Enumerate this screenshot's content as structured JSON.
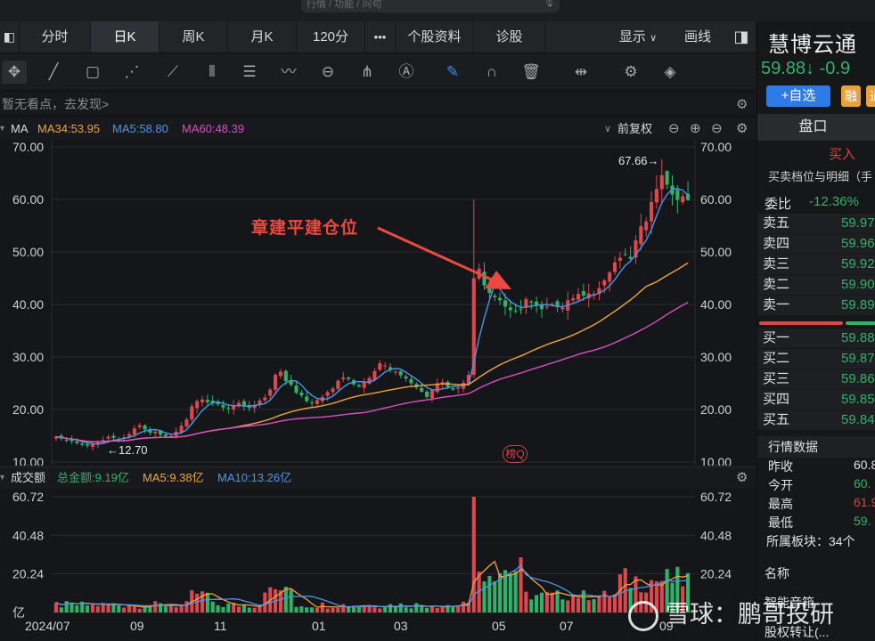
{
  "search": {
    "placeholder": "行情 / 功能 / 问句"
  },
  "tabs": [
    {
      "label": "分时"
    },
    {
      "label": "日K"
    },
    {
      "label": "周K"
    },
    {
      "label": "月K"
    },
    {
      "label": "120分"
    },
    {
      "label": "•••"
    },
    {
      "label": "个股资料"
    },
    {
      "label": "诊股"
    }
  ],
  "toolbar": {
    "display_label": "显示",
    "draw_label": "画线"
  },
  "notice": {
    "text": "暂无看点，去发现>"
  },
  "ma": {
    "label": "MA",
    "ma34": "MA34:53.95",
    "ma5": "MA5:58.80",
    "ma60": "MA60:48.39",
    "adjust": "前复权"
  },
  "volume": {
    "label": "成交额",
    "total": "总金额:9.19亿",
    "ma5": "MA5:9.38亿",
    "ma10": "MA10:13.26亿"
  },
  "annotation": {
    "text": "章建平建仓位"
  },
  "badge": {
    "text": "榜Q"
  },
  "colors": {
    "up": "#e0474c",
    "down": "#2fb36b",
    "ma5": "#4c95ea",
    "ma34": "#f2a33a",
    "ma60": "#d94fc4",
    "accent": "#e8463c"
  },
  "chart_data": [
    {
      "type": "candlestick",
      "title": "",
      "yticks_left": [
        "70.00",
        "60.00",
        "50.00",
        "40.00",
        "30.00",
        "20.00",
        "10.00"
      ],
      "yticks_right": [
        "70.00",
        "60.00",
        "50.00",
        "40.00",
        "30.00",
        "20.00",
        "10.00"
      ],
      "ylim": [
        10,
        70
      ],
      "xticks": [
        "2024/07",
        "09",
        "11",
        "01",
        "03",
        "05",
        "07",
        "09"
      ],
      "high_label": "67.66",
      "low_label": "12.70",
      "close_series": [
        14.8,
        14.5,
        14.2,
        14.0,
        13.6,
        13.3,
        13.1,
        13.4,
        13.7,
        14.2,
        14.8,
        14.6,
        14.2,
        14.7,
        15.3,
        16.4,
        17.0,
        16.2,
        15.6,
        15.8,
        15.2,
        14.9,
        15.0,
        15.8,
        16.9,
        18.1,
        20.6,
        21.6,
        21.9,
        21.4,
        21.2,
        21.0,
        20.4,
        20.2,
        20.8,
        21.3,
        20.6,
        20.3,
        20.8,
        21.7,
        22.3,
        23.8,
        26.6,
        27.2,
        25.4,
        24.7,
        23.2,
        22.7,
        21.6,
        21.2,
        21.8,
        22.4,
        23.3,
        24.0,
        25.5,
        26.1,
        25.8,
        24.8,
        24.4,
        25.2,
        26.0,
        27.3,
        28.8,
        28.4,
        27.5,
        27.2,
        26.5,
        25.9,
        25.0,
        24.2,
        23.4,
        22.4,
        23.7,
        25.0,
        25.2,
        24.3,
        23.8,
        24.2,
        25.1,
        26.6,
        45.0,
        46.8,
        43.6,
        42.2,
        41.4,
        40.8,
        39.6,
        38.9,
        38.7,
        39.2,
        41.0,
        40.5,
        39.8,
        39.1,
        39.6,
        40.1,
        39.5,
        39.4,
        40.8,
        41.2,
        42.0,
        41.7,
        42.1,
        42.0,
        43.1,
        44.6,
        46.1,
        48.0,
        48.9,
        49.5,
        48.7,
        52.2,
        54.9,
        55.8,
        59.5,
        62.0,
        64.6,
        62.8,
        60.9,
        59.9,
        60.6,
        59.9
      ]
    },
    {
      "type": "bar",
      "title": "",
      "yticks_left": [
        "60.72",
        "40.48",
        "20.24",
        "亿"
      ],
      "yticks_right": [
        "60.72",
        "40.48",
        "20.24"
      ],
      "ylim": [
        0,
        60.72
      ],
      "unit": "亿"
    }
  ],
  "quote": {
    "name": "慧博云通",
    "price": "59.88↓",
    "change": "-0.9",
    "add_watch": "+自选",
    "rong": "融",
    "tong": "通"
  },
  "panel": {
    "title": "盘口",
    "buy_tab": "买入",
    "depth_title": "买卖档位与明细（手",
    "weibi_label": "委比",
    "weibi_value": "-12.36%",
    "asks": [
      {
        "label": "卖五",
        "price": "59.97"
      },
      {
        "label": "卖四",
        "price": "59.96"
      },
      {
        "label": "卖三",
        "price": "59.92"
      },
      {
        "label": "卖二",
        "price": "59.90"
      },
      {
        "label": "卖一",
        "price": "59.89"
      }
    ],
    "bids": [
      {
        "label": "买一",
        "price": "59.88"
      },
      {
        "label": "买二",
        "price": "59.87"
      },
      {
        "label": "买三",
        "price": "59.86"
      },
      {
        "label": "买四",
        "price": "59.85"
      },
      {
        "label": "买五",
        "price": "59.84"
      }
    ],
    "market_title": "行情数据",
    "market": [
      {
        "label": "昨收",
        "value": "60.8"
      },
      {
        "label": "今开",
        "value": "60."
      },
      {
        "label": "最高",
        "value": "61.9"
      },
      {
        "label": "最低",
        "value": "59."
      }
    ],
    "sector": "所属板块：34个",
    "name_col": "名称",
    "sector_1": "智能音箱",
    "sector_2": "股权转让(..."
  },
  "watermark": {
    "text": "雪球：鹏哥投研"
  }
}
